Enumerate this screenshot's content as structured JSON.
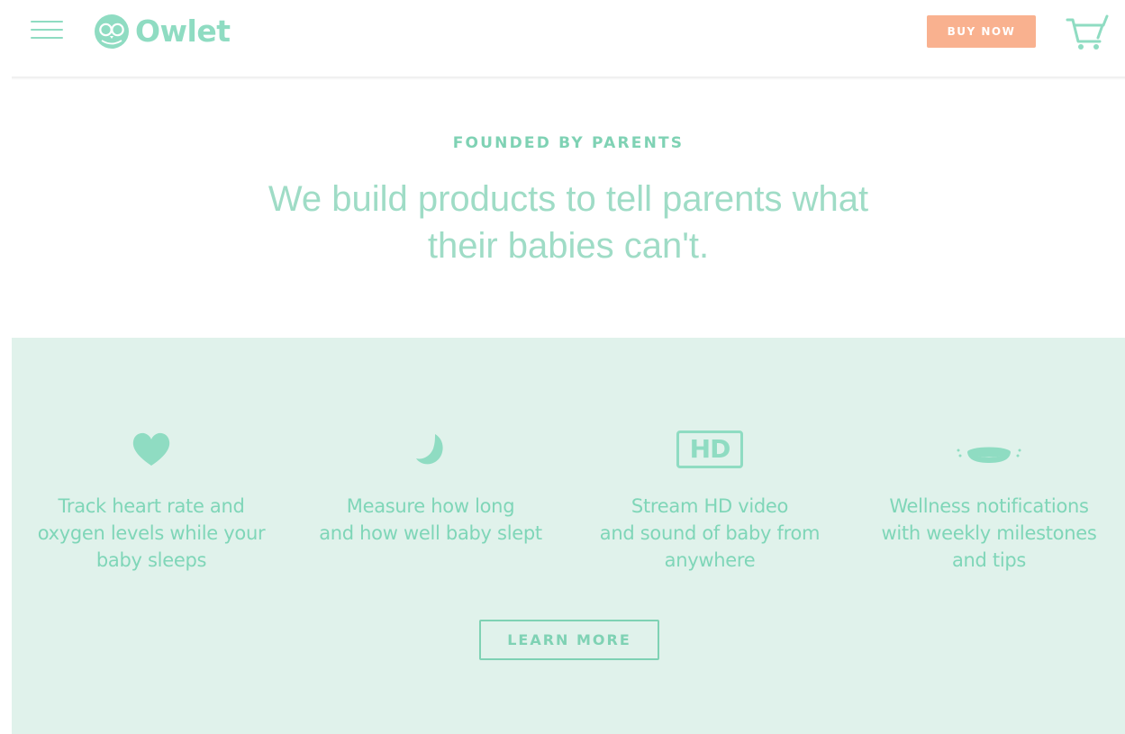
{
  "header": {
    "brand": "Owlet",
    "buy_label": "BUY NOW",
    "icons": {
      "menu": "hamburger-icon",
      "logo": "owl-icon",
      "cart": "cart-icon"
    }
  },
  "hero": {
    "eyebrow": "FOUNDED BY PARENTS",
    "tagline_line1": "We build products to tell parents what",
    "tagline_line2": "their babies can't."
  },
  "features": {
    "items": [
      {
        "icon": "heart-icon",
        "line1": "Track heart rate and",
        "line2": "oxygen levels while your",
        "line3": "baby sleeps"
      },
      {
        "icon": "moon-icon",
        "line1": "Measure how long",
        "line2": "and how well baby slept",
        "line3": ""
      },
      {
        "icon": "hd-icon",
        "icon_text": "HD",
        "line1": "Stream HD video",
        "line2": "and sound of baby from",
        "line3": "anywhere"
      },
      {
        "icon": "base-station-icon",
        "line1": "Wellness notifications",
        "line2": "with weekly milestones",
        "line3": "and tips"
      }
    ],
    "learn_label": "LEARN MORE"
  },
  "colors": {
    "brand_mint": "#8fdcc2",
    "text_mint": "#7fd6b8",
    "section_bg": "#e0f2eb",
    "buy_button": "#f9b18f"
  }
}
